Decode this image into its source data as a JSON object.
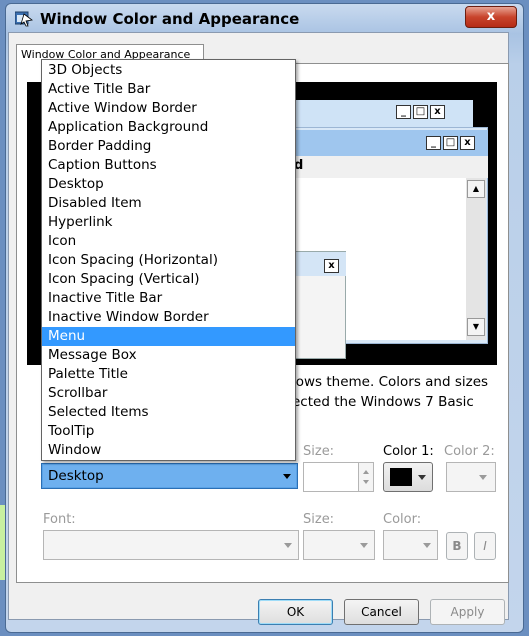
{
  "window": {
    "title": "Window Color and Appearance",
    "close_glyph": "x"
  },
  "tab": {
    "label": "Window Color and Appearance"
  },
  "preview": {
    "active_menu_text": "d",
    "minimize_glyph": "_",
    "maximize_glyph": "□",
    "close_glyph": "x",
    "scroll_up_glyph": "▲",
    "scroll_down_glyph": "▼"
  },
  "description": {
    "line1": "lows theme.  Colors and sizes",
    "line2": "ected the Windows 7 Basic"
  },
  "item": {
    "selected_value": "Desktop",
    "options": [
      "3D Objects",
      "Active Title Bar",
      "Active Window Border",
      "Application Background",
      "Border Padding",
      "Caption Buttons",
      "Desktop",
      "Disabled Item",
      "Hyperlink",
      "Icon",
      "Icon Spacing (Horizontal)",
      "Icon Spacing (Vertical)",
      "Inactive Title Bar",
      "Inactive Window Border",
      "Menu",
      "Message Box",
      "Palette Title",
      "Scrollbar",
      "Selected Items",
      "ToolTip",
      "Window"
    ],
    "highlighted_option": "Menu"
  },
  "item_controls": {
    "size_label": "Size:",
    "color1_label": "Color 1:",
    "color2_label": "Color 2:",
    "color1_value": "#000000"
  },
  "font_controls": {
    "font_label": "Font:",
    "size_label": "Size:",
    "color_label": "Color:",
    "bold_label": "B",
    "italic_label": "I"
  },
  "buttons": {
    "ok": "OK",
    "cancel": "Cancel",
    "apply": "Apply"
  },
  "colors": {
    "selection": "#3399ff",
    "title_bar_active": "#9fc6ee",
    "preview_background": "#000000"
  }
}
